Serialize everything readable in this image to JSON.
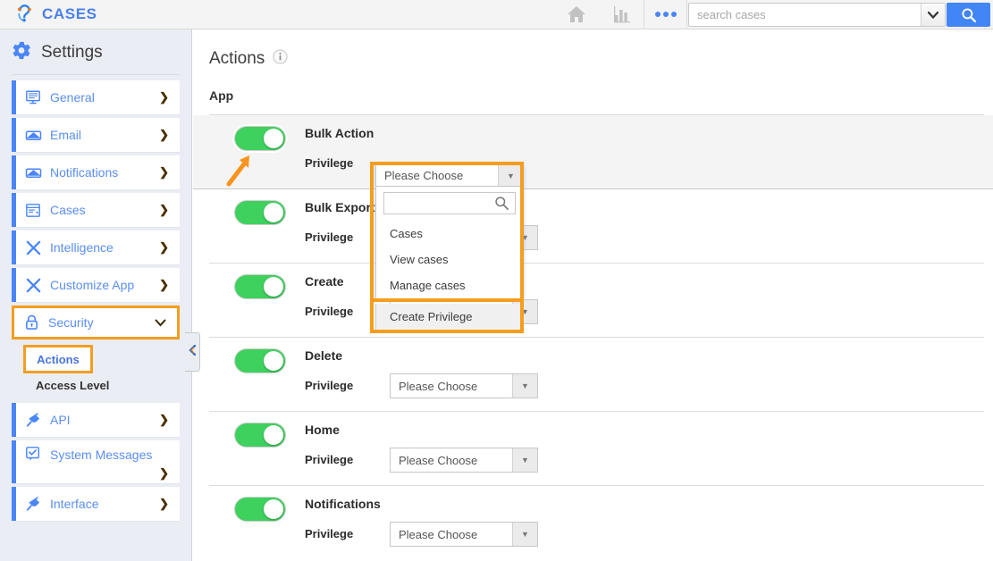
{
  "header": {
    "brand_title": "CASES",
    "brand_logo_icon": "question-mark-logo-icon",
    "home_icon": "home-icon",
    "reports_icon": "bar-chart-icon",
    "more_icon": "ellipsis-icon",
    "search_placeholder": "search cases",
    "search_value": "",
    "search_caret_icon": "chevron-down-icon",
    "search_button_icon": "search-icon"
  },
  "sidebar": {
    "title": "Settings",
    "gear_icon": "gear-icon",
    "items": [
      {
        "label": "General",
        "icon": "monitor-icon",
        "chevron": "❯",
        "highlighted": false
      },
      {
        "label": "Email",
        "icon": "envelope-icon",
        "chevron": "❯",
        "highlighted": false
      },
      {
        "label": "Notifications",
        "icon": "envelope-icon",
        "chevron": "❯",
        "highlighted": false
      },
      {
        "label": "Cases",
        "icon": "window-icon",
        "chevron": "❯",
        "highlighted": false
      },
      {
        "label": "Intelligence",
        "icon": "tools-icon",
        "chevron": "❯",
        "highlighted": false
      },
      {
        "label": "Customize App",
        "icon": "tools-icon",
        "chevron": "❯",
        "highlighted": false
      },
      {
        "label": "Security",
        "icon": "lock-icon",
        "chevron": "❮",
        "highlighted": true
      }
    ],
    "sub_items": [
      {
        "label": "Actions",
        "highlighted": true,
        "active": true
      },
      {
        "label": "Access Level",
        "highlighted": false,
        "active": false
      }
    ],
    "items_after": [
      {
        "label": "API",
        "icon": "plug-icon",
        "chevron": "❯"
      },
      {
        "label": "System Messages",
        "icon": "checkbox-icon",
        "chevron": "❯"
      },
      {
        "label": "Interface",
        "icon": "plug-icon",
        "chevron": "❯"
      }
    ],
    "collapse_icon": "chevron-left-icon"
  },
  "main": {
    "page_title": "Actions",
    "info_icon": "info-icon",
    "section_label": "App",
    "privilege_label": "Privilege",
    "select_placeholder": "Please Choose",
    "select_arrow_icon": "caret-down-icon",
    "rows": [
      {
        "title": "Bulk Action",
        "toggle_on": true,
        "privilege_value": "Please Choose",
        "dropdown_open": true,
        "shaded": true
      },
      {
        "title": "Bulk Export",
        "toggle_on": true,
        "privilege_value": "Please Choose",
        "dropdown_open": false,
        "shaded": false
      },
      {
        "title": "Create",
        "toggle_on": true,
        "privilege_value": "Please Choose",
        "dropdown_open": false,
        "shaded": false
      },
      {
        "title": "Delete",
        "toggle_on": true,
        "privilege_value": "Please Choose",
        "dropdown_open": false,
        "shaded": false
      },
      {
        "title": "Home",
        "toggle_on": true,
        "privilege_value": "Please Choose",
        "dropdown_open": false,
        "shaded": false
      },
      {
        "title": "Notifications",
        "toggle_on": true,
        "privilege_value": "Please Choose",
        "dropdown_open": false,
        "shaded": false
      }
    ]
  },
  "dropdown": {
    "control_value": "Please Choose",
    "control_arrow_icon": "caret-down-icon",
    "search_value": "",
    "search_icon": "search-icon",
    "options": [
      {
        "label": "Cases",
        "selected": false
      },
      {
        "label": "View cases",
        "selected": false
      },
      {
        "label": "Manage cases",
        "selected": false
      }
    ],
    "footer_option": {
      "label": "Create Privilege",
      "selected": true
    }
  },
  "annotations": {
    "arrow_icon": "arrow-up-right-annotation",
    "highlight_color": "#f59d1f",
    "accent_color": "#4285f4",
    "toggle_on_color": "#3ed15e"
  }
}
